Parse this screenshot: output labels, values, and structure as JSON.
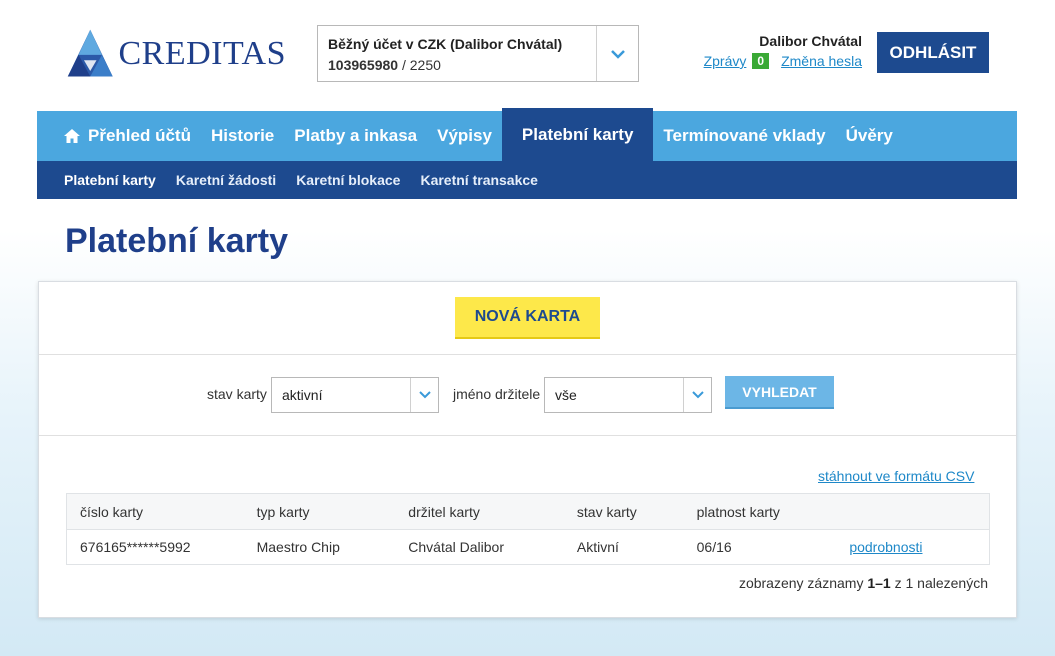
{
  "brand": {
    "name": "CREDITAS",
    "color": "#1f3f8a"
  },
  "account": {
    "name": "Běžný účet v CZK (Dalibor Chvátal)",
    "number": "103965980",
    "bank_code": " / 2250"
  },
  "user": {
    "name": "Dalibor Chvátal",
    "messages_label": "Zprávy",
    "messages_count": "0",
    "change_password_label": "Změna hesla",
    "logout_label": "ODHLÁSIT"
  },
  "main_nav": [
    {
      "label": "Přehled účtů",
      "icon": "home-icon"
    },
    {
      "label": "Historie"
    },
    {
      "label": "Platby a inkasa"
    },
    {
      "label": "Výpisy"
    },
    {
      "label": "Platební karty",
      "active": true
    },
    {
      "label": "Termínované vklady"
    },
    {
      "label": "Úvěry"
    }
  ],
  "sub_nav": [
    {
      "label": "Platební karty",
      "active": true
    },
    {
      "label": "Karetní žádosti"
    },
    {
      "label": "Karetní blokace"
    },
    {
      "label": "Karetní transakce"
    }
  ],
  "page_title": "Platební karty",
  "new_card_label": "NOVÁ KARTA",
  "filters": {
    "card_state_label": "stav karty",
    "card_state_value": "aktivní",
    "holder_label": "jméno držitele",
    "holder_value": "vše",
    "search_label": "VYHLEDAT"
  },
  "csv_link": "stáhnout ve formátu CSV",
  "table": {
    "headers": [
      "číslo karty",
      "typ karty",
      "držitel karty",
      "stav karty",
      "platnost karty"
    ],
    "rows": [
      {
        "number": "676165******5992",
        "type": "Maestro Chip",
        "holder": "Chvátal Dalibor",
        "state": "Aktivní",
        "validity": "06/16",
        "details": "podrobnosti"
      }
    ]
  },
  "records": {
    "prefix": "zobrazeny záznamy ",
    "range": "1–1",
    "middle": " z ",
    "total": "1",
    "suffix": " nalezených"
  },
  "colors": {
    "nav_light": "#4ba7df",
    "nav_dark": "#1d4a8f",
    "accent_yellow": "#fde84a",
    "link": "#1e88c8",
    "badge_green": "#3aa935"
  }
}
